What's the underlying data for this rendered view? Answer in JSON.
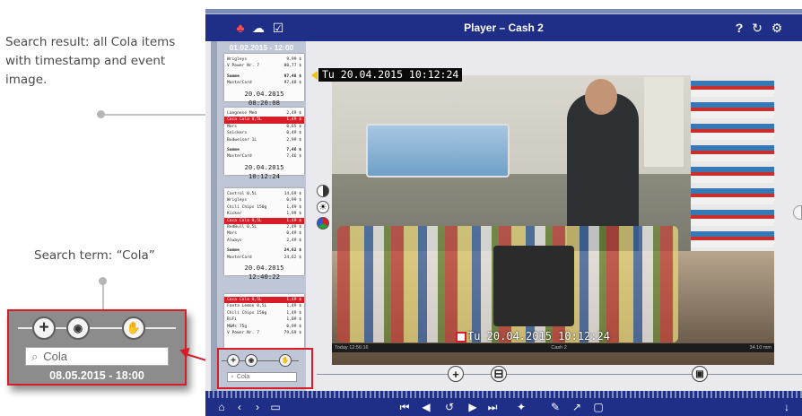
{
  "annotations": {
    "search_result": "Search result: all Cola items with timestamp and event image.",
    "search_term": "Search term: “Cola”"
  },
  "zoom": {
    "search_value": "Cola",
    "date": "08.05.2015 - 18:00"
  },
  "window": {
    "title": "Player – Cash 2"
  },
  "list": {
    "header_date": "01.02.2015 - 12:00",
    "search_value": "Cola",
    "receipts": [
      {
        "rows": [
          {
            "item": "Wrigleys",
            "price": "9,99 $"
          },
          {
            "item": "V Power Nr. 7",
            "price": "80,77 $"
          },
          {
            "item": "Summe",
            "price": "97,48 $",
            "bold": true
          },
          {
            "item": "MasterCard",
            "price": "97,48 $"
          }
        ],
        "timestamp": "20.04.2015 08:20:08"
      },
      {
        "rows": [
          {
            "item": "Langnese Med",
            "price": "2,49 $"
          },
          {
            "item": "Coca Cola 0,5L",
            "price": "1,49 $",
            "highlight": true
          },
          {
            "item": "Mars",
            "price": "0,65 $"
          },
          {
            "item": "Snickers",
            "price": "0,49 $"
          },
          {
            "item": "Budweiser 1L",
            "price": "2,99 $"
          },
          {
            "item": "Summe",
            "price": "7,46 $",
            "bold": true
          },
          {
            "item": "MasterCard",
            "price": "7,46 $"
          }
        ],
        "timestamp": "20.04.2015 10:12:24"
      },
      {
        "rows": [
          {
            "item": "Castrol 0,5L",
            "price": "14,69 $"
          },
          {
            "item": "Wrigleys",
            "price": "0,99 $"
          },
          {
            "item": "Chili Chips 150g",
            "price": "1,49 $"
          },
          {
            "item": "Kicker",
            "price": "1,99 $"
          },
          {
            "item": "Coca Cola 0,5L",
            "price": "1,49 $",
            "highlight": true
          },
          {
            "item": "RedBull 0,5L",
            "price": "2,49 $"
          },
          {
            "item": "Mars",
            "price": "0,49 $"
          },
          {
            "item": "Always",
            "price": "2,49 $"
          },
          {
            "item": "Summe",
            "price": "24,62 $",
            "bold": true
          },
          {
            "item": "MasterCard",
            "price": "24,62 $"
          }
        ],
        "timestamp": "20.04.2015 12:40:22"
      },
      {
        "rows": [
          {
            "item": "Coca Cola 0,5L",
            "price": "1,49 $",
            "highlight": true
          },
          {
            "item": "Fanta Lemon 0,5L",
            "price": "1,49 $"
          },
          {
            "item": "Chili Chips 150g",
            "price": "1,49 $"
          },
          {
            "item": "BiFi",
            "price": "1,09 $"
          },
          {
            "item": "M&Ms 75g",
            "price": "0,99 $"
          },
          {
            "item": "V Power Nr. 7",
            "price": "79,69 $"
          }
        ],
        "timestamp": ""
      }
    ]
  },
  "video": {
    "timestamp_overlay": "Tu 20.04.2015   10:12:24",
    "timestamp_bottom": "Tu 20.04.2015  10:12:24",
    "caption_left": "Today 12:56:16",
    "caption_center": "Cash 2",
    "caption_right": "34.10 mm"
  },
  "colors": {
    "title_bar": "#1f2f87",
    "highlight_red": "#d71d27"
  },
  "icons": {
    "titlebar_left": [
      "flashlight-icon",
      "speech-bubble-icon",
      "checkbox-icon"
    ],
    "titlebar_right": [
      "help-icon",
      "refresh-icon",
      "settings-icon"
    ],
    "bottombar": [
      "home-icon",
      "back-icon",
      "forward-icon",
      "camera-icon",
      "skip-start-icon",
      "step-back-icon",
      "rotate-icon",
      "play-icon",
      "skip-end-icon",
      "graph-icon",
      "pen-icon",
      "export-icon",
      "snapshot-icon",
      "pin-icon"
    ]
  }
}
